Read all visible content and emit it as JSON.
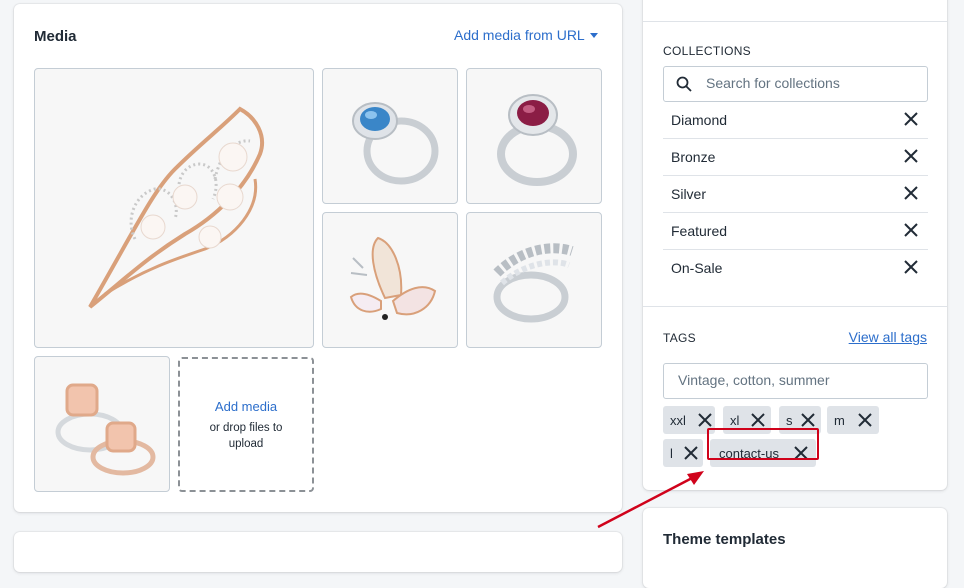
{
  "media": {
    "title": "Media",
    "add_from_url_label": "Add media from URL",
    "drop_zone": {
      "add_label": "Add media",
      "hint": "or drop files to upload"
    }
  },
  "organization": {
    "collections": {
      "heading": "COLLECTIONS",
      "search_placeholder": "Search for collections",
      "items": [
        "Diamond",
        "Bronze",
        "Silver",
        "Featured",
        "On-Sale"
      ]
    },
    "tags": {
      "heading": "TAGS",
      "view_all_label": "View all tags",
      "input_placeholder": "Vintage, cotton, summer",
      "items": [
        "xxl",
        "xl",
        "s",
        "m",
        "l",
        "contact-us"
      ]
    }
  },
  "theme_templates": {
    "title": "Theme templates"
  },
  "colors": {
    "accent": "#2c6ecb",
    "annotation": "#d0021b"
  }
}
